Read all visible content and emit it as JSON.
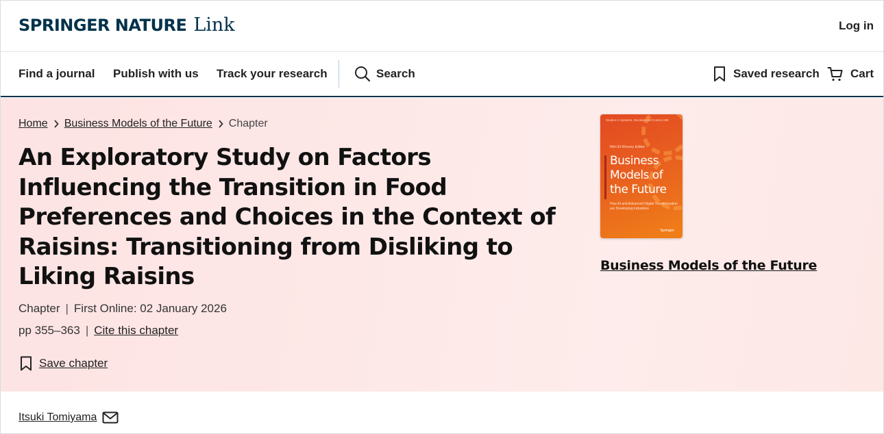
{
  "header": {
    "brand_primary": "SPRINGER NATURE",
    "brand_secondary": "Link",
    "login": "Log in"
  },
  "nav": {
    "items": [
      "Find a journal",
      "Publish with us",
      "Track your research"
    ],
    "search": "Search",
    "saved_research": "Saved research",
    "cart": "Cart"
  },
  "breadcrumb": {
    "home": "Home",
    "book": "Business Models of the Future",
    "current": "Chapter"
  },
  "chapter": {
    "title": "An Exploratory Study on Factors Influencing the Transition in Food Preferences and Choices in the Context of Raisins: Transitioning from Disliking to Liking Raisins",
    "type": "Chapter",
    "first_online": "First Online: 02 January 2026",
    "pages": "pp 355–363",
    "cite": "Cite this chapter",
    "save": "Save chapter"
  },
  "book": {
    "title": "Business Models of the Future",
    "cover": {
      "series": "Studies in Systems, Decision and Control 238",
      "editor": "Rim El Khoury   Editor",
      "title": "Business Models of the Future",
      "subtitle": "How AI and Advanced Digital Transformation are Developing Industries",
      "publisher": "Springer"
    }
  },
  "authors": [
    {
      "name": "Itsuki Tomiyama"
    }
  ],
  "colors": {
    "brand": "#01324b",
    "hero_bg": "#fde6e5",
    "cover_orange": "#e85f1f"
  }
}
